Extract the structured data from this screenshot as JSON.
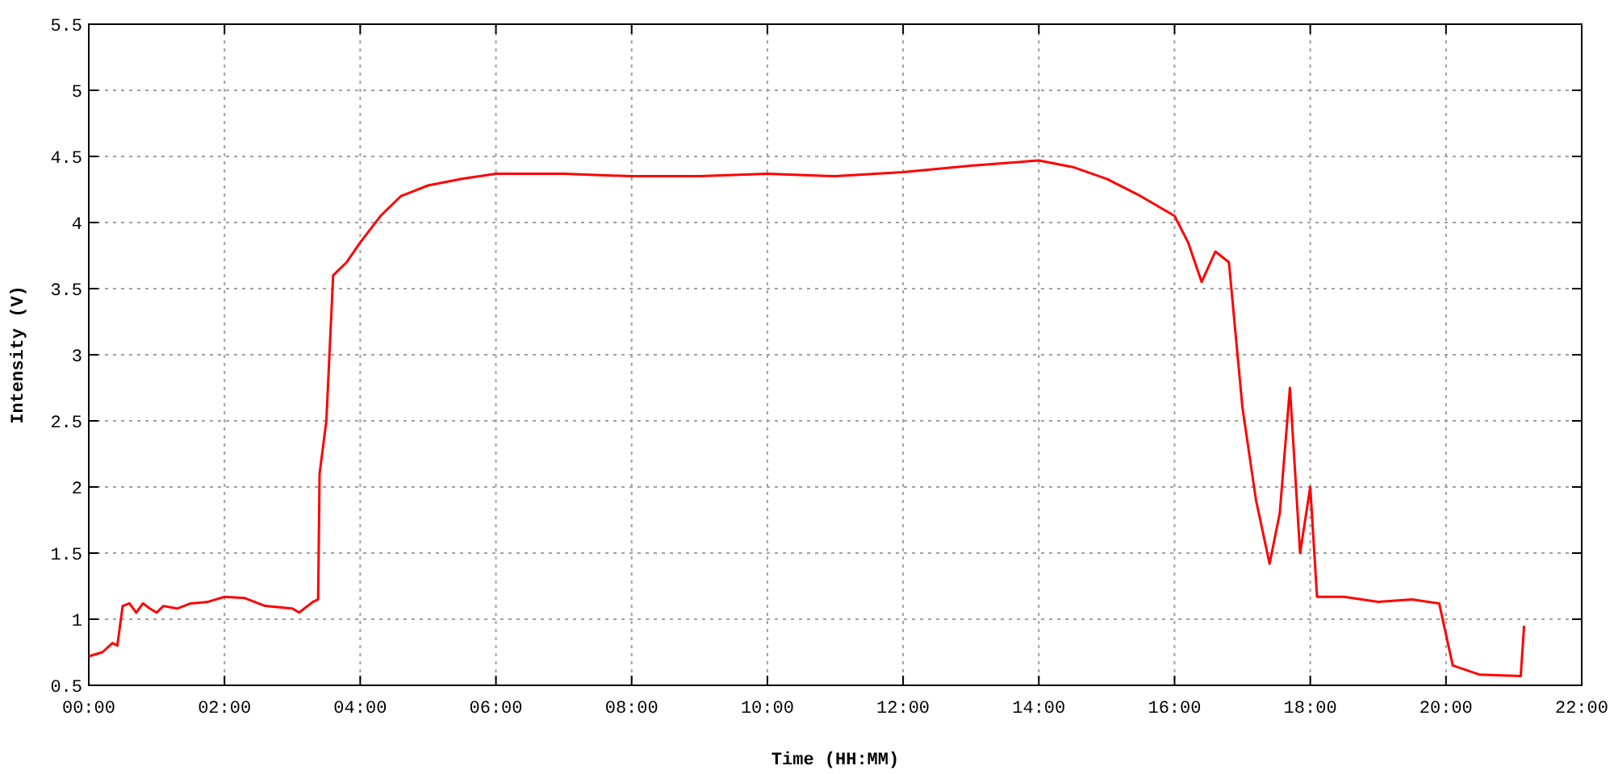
{
  "chart": {
    "chart_data": {
      "type": "line",
      "xlabel": "Time (HH:MM)",
      "ylabel": "Intensity (V)",
      "x": [
        0,
        0.2,
        0.35,
        0.42,
        0.5,
        0.6,
        0.7,
        0.8,
        0.9,
        1.0,
        1.1,
        1.3,
        1.5,
        1.75,
        2.0,
        2.3,
        2.6,
        3.0,
        3.1,
        3.3,
        3.38,
        3.4,
        3.5,
        3.6,
        3.8,
        4.0,
        4.3,
        4.6,
        5,
        5.5,
        6,
        7,
        8,
        9,
        10,
        11,
        12,
        13,
        14,
        14.5,
        15,
        15.5,
        16,
        16.2,
        16.4,
        16.6,
        16.8,
        17,
        17.2,
        17.4,
        17.55,
        17.7,
        17.85,
        18.0,
        18.1,
        18.5,
        19,
        19.5,
        19.9,
        20.1,
        20.5,
        21.1,
        21.15
      ],
      "series": [
        {
          "color": "#ff0000",
          "values": [
            0.72,
            0.75,
            0.82,
            0.8,
            1.1,
            1.12,
            1.05,
            1.12,
            1.08,
            1.05,
            1.1,
            1.08,
            1.12,
            1.13,
            1.17,
            1.16,
            1.1,
            1.08,
            1.05,
            1.13,
            1.15,
            2.1,
            2.5,
            3.6,
            3.7,
            3.85,
            4.05,
            4.2,
            4.28,
            4.33,
            4.37,
            4.37,
            4.35,
            4.35,
            4.37,
            4.35,
            4.38,
            4.43,
            4.47,
            4.42,
            4.33,
            4.2,
            4.05,
            3.85,
            3.55,
            3.78,
            3.7,
            2.6,
            1.9,
            1.42,
            1.8,
            2.75,
            1.5,
            2.0,
            1.17,
            1.17,
            1.13,
            1.15,
            1.12,
            0.65,
            0.58,
            0.57,
            0.95
          ]
        }
      ],
      "grid": true,
      "xlim": [
        0,
        22
      ],
      "ylim": [
        0.5,
        5.5
      ],
      "xticks": [
        {
          "value": 0,
          "label": "00:00"
        },
        {
          "value": 2,
          "label": "02:00"
        },
        {
          "value": 4,
          "label": "04:00"
        },
        {
          "value": 6,
          "label": "06:00"
        },
        {
          "value": 8,
          "label": "08:00"
        },
        {
          "value": 10,
          "label": "10:00"
        },
        {
          "value": 12,
          "label": "12:00"
        },
        {
          "value": 14,
          "label": "14:00"
        },
        {
          "value": 16,
          "label": "16:00"
        },
        {
          "value": 18,
          "label": "18:00"
        },
        {
          "value": 20,
          "label": "20:00"
        },
        {
          "value": 22,
          "label": "22:00"
        }
      ],
      "yticks": [
        0.5,
        1,
        1.5,
        2,
        2.5,
        3,
        3.5,
        4,
        4.5,
        5,
        5.5
      ]
    }
  }
}
